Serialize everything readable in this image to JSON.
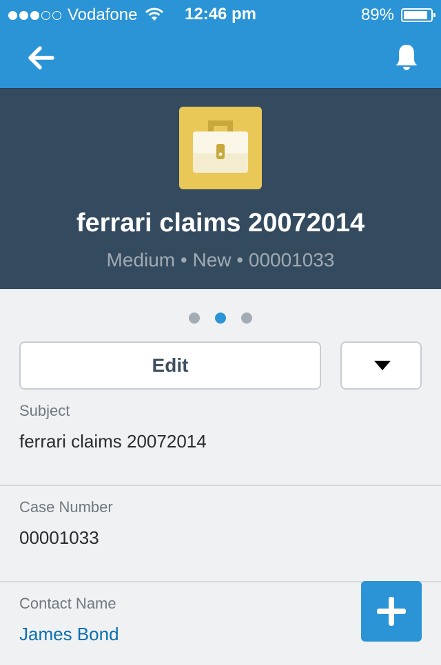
{
  "status_bar": {
    "carrier": "Vodafone",
    "signal_bars_filled": 3,
    "signal_bars_total": 5,
    "time": "12:46 pm",
    "battery_label": "89%",
    "battery_level": 0.89
  },
  "nav": {
    "back_icon": "back-arrow-icon",
    "notifications_icon": "bell-icon",
    "accent_color": "#2a94d6"
  },
  "record": {
    "icon": "briefcase-icon",
    "icon_color": "#eac858",
    "title": "ferrari claims 20072014",
    "meta": "Medium • New • 00001033"
  },
  "pager": {
    "pages": 3,
    "active_index": 1
  },
  "actions": {
    "edit_label": "Edit",
    "more_icon": "caret-down-icon"
  },
  "fields": [
    {
      "label": "Subject",
      "value": "ferrari claims 20072014",
      "is_link": false
    },
    {
      "label": "Case Number",
      "value": "00001033",
      "is_link": false
    },
    {
      "label": "Contact Name",
      "value": "James Bond",
      "is_link": true
    }
  ],
  "fab": {
    "icon": "plus-icon"
  }
}
